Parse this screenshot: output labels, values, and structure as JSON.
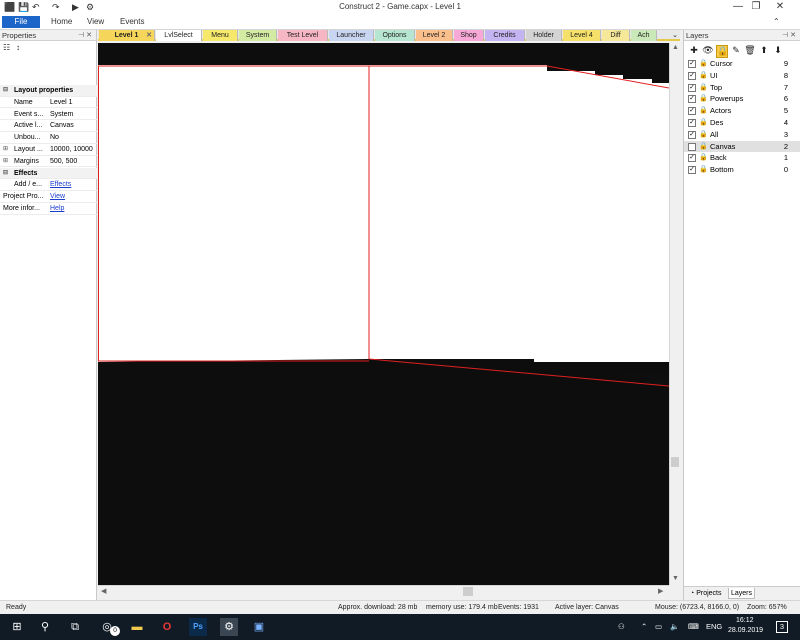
{
  "window": {
    "title": "Construct 2 - Game.capx - Level 1",
    "controls": {
      "minimize": "—",
      "maximize": "❐",
      "close": "✕"
    }
  },
  "ribbon": {
    "tabs": [
      "File",
      "Home",
      "View",
      "Events"
    ]
  },
  "properties": {
    "header": "Properties",
    "rows": [
      {
        "type": "section",
        "label": "Layout properties"
      },
      {
        "type": "prop",
        "key": "Name",
        "value": "Level 1"
      },
      {
        "type": "prop",
        "key": "Event s...",
        "value": "System"
      },
      {
        "type": "prop",
        "key": "Active l...",
        "value": "Canvas"
      },
      {
        "type": "prop",
        "key": "Unbou...",
        "value": "No"
      },
      {
        "type": "prop",
        "key": "Layout ...",
        "value": "10000, 10000",
        "expandable": true
      },
      {
        "type": "prop",
        "key": "Margins",
        "value": "500, 500",
        "expandable": true
      },
      {
        "type": "section",
        "label": "Effects"
      },
      {
        "type": "prop",
        "key": "Add / e...",
        "value": "Effects",
        "link": true
      },
      {
        "type": "prop",
        "key": "Project Pro...",
        "value": "View",
        "link": true,
        "full": true
      },
      {
        "type": "prop",
        "key": "More infor...",
        "value": "Help",
        "link": true,
        "full": true
      }
    ]
  },
  "doc_tabs": [
    {
      "label": "Level 1",
      "color": "#f5d55a",
      "active": true,
      "width": 56
    },
    {
      "label": "LvlSelect",
      "color": "#ffffff",
      "width": 46
    },
    {
      "label": "Menu",
      "color": "#f5e86a",
      "width": 35
    },
    {
      "label": "System",
      "color": "#d3eaa3",
      "width": 38
    },
    {
      "label": "Test Level",
      "color": "#f7b6c3",
      "width": 50
    },
    {
      "label": "Launcher",
      "color": "#c9d6f2",
      "width": 45
    },
    {
      "label": "Options",
      "color": "#b6e6d2",
      "width": 40
    },
    {
      "label": "Level 2",
      "color": "#fbbf8c",
      "width": 37
    },
    {
      "label": "Shop",
      "color": "#f7a8d6",
      "width": 30
    },
    {
      "label": "Credits",
      "color": "#c4b4f2",
      "width": 40
    },
    {
      "label": "Holder",
      "color": "#d3d3d3",
      "width": 36
    },
    {
      "label": "Level 4",
      "color": "#f5e06a",
      "width": 38
    },
    {
      "label": "Diff",
      "color": "#f5e898",
      "width": 28
    },
    {
      "label": "Ach",
      "color": "#c9eab8",
      "width": 26
    }
  ],
  "layers": {
    "header": "Layers",
    "items": [
      {
        "name": "Cursor",
        "num": "9",
        "visible": true,
        "locked": false
      },
      {
        "name": "UI",
        "num": "8",
        "visible": true,
        "locked": false
      },
      {
        "name": "Top",
        "num": "7",
        "visible": true,
        "locked": false
      },
      {
        "name": "Powerups",
        "num": "6",
        "visible": true,
        "locked": false
      },
      {
        "name": "Actors",
        "num": "5",
        "visible": true,
        "locked": false
      },
      {
        "name": "Des",
        "num": "4",
        "visible": true,
        "locked": false
      },
      {
        "name": "All",
        "num": "3",
        "visible": true,
        "locked": false
      },
      {
        "name": "Canvas",
        "num": "2",
        "visible": false,
        "locked": false,
        "selected": true
      },
      {
        "name": "Back",
        "num": "1",
        "visible": true,
        "locked": true
      },
      {
        "name": "Bottom",
        "num": "0",
        "visible": true,
        "locked": true
      }
    ],
    "bottom_tabs": [
      "Projects",
      "Layers"
    ]
  },
  "status": {
    "ready": "Ready",
    "download": "Approx. download: 28 mb",
    "memory": "memory use: 179.4 mb",
    "events": "Events: 1931",
    "active_layer": "Active layer: Canvas",
    "mouse": "Mouse: (6723.4, 8166.0, 0)",
    "zoom": "Zoom: 657%"
  },
  "taskbar": {
    "time": "16:12",
    "date": "28.09.2019",
    "lang": "ENG",
    "badge": "0",
    "notifications": "3"
  }
}
